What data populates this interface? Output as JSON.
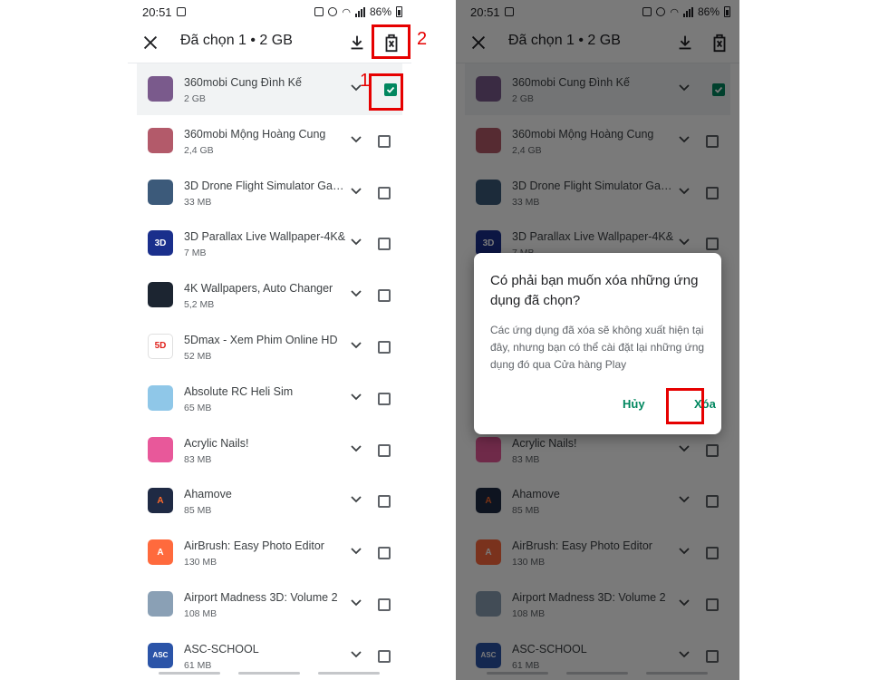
{
  "status_bar": {
    "time": "20:51",
    "battery": "86%"
  },
  "app_bar": {
    "title": "Đã chọn 1 • 2 GB",
    "close_icon": "close-icon",
    "download_icon": "download-icon",
    "delete_icon": "delete-icon"
  },
  "apps": [
    {
      "name": "360mobi Cung Đình Kế",
      "size": "2 GB",
      "checked": true,
      "icon_color": "#7a5a8c",
      "icon_text": ""
    },
    {
      "name": "360mobi Mộng Hoàng Cung",
      "size": "2,4 GB",
      "checked": false,
      "icon_color": "#b35a6a",
      "icon_text": ""
    },
    {
      "name": "3D Drone Flight Simulator Game",
      "size": "33 MB",
      "checked": false,
      "icon_color": "#3c5a7a",
      "icon_text": ""
    },
    {
      "name": "3D Parallax Live Wallpaper-4K&",
      "size": "7 MB",
      "checked": false,
      "icon_color": "#1a2f8c",
      "icon_text": "3D"
    },
    {
      "name": "4K Wallpapers, Auto Changer",
      "size": "5,2 MB",
      "checked": false,
      "icon_color": "#1c2531",
      "icon_text": ""
    },
    {
      "name": "5Dmax - Xem Phim Online HD",
      "size": "52 MB",
      "checked": false,
      "icon_color": "#ffffff",
      "icon_text": "5D"
    },
    {
      "name": "Absolute RC Heli Sim",
      "size": "65 MB",
      "checked": false,
      "icon_color": "#8fc7e8",
      "icon_text": ""
    },
    {
      "name": "Acrylic Nails!",
      "size": "83 MB",
      "checked": false,
      "icon_color": "#e8589a",
      "icon_text": ""
    },
    {
      "name": "Ahamove",
      "size": "85 MB",
      "checked": false,
      "icon_color": "#1f2a44",
      "icon_text": "A"
    },
    {
      "name": "AirBrush: Easy Photo Editor",
      "size": "130 MB",
      "checked": false,
      "icon_color": "#ff6a3d",
      "icon_text": "A"
    },
    {
      "name": "Airport Madness 3D: Volume 2",
      "size": "108 MB",
      "checked": false,
      "icon_color": "#8aa0b5",
      "icon_text": ""
    },
    {
      "name": "ASC-SCHOOL",
      "size": "61 MB",
      "checked": false,
      "icon_color": "#2b54a8",
      "icon_text": "ASC"
    }
  ],
  "dialog": {
    "title": "Có phải bạn muốn xóa những ứng dụng đã chọn?",
    "body": "Các ứng dụng đã xóa sẽ không xuất hiện tại đây, nhưng bạn có thể cài đặt lại những ứng dụng đó qua Cửa hàng Play",
    "cancel_label": "Hủy",
    "confirm_label": "Xóa"
  },
  "annotations": {
    "step1": "1",
    "step2": "2"
  },
  "colors": {
    "accent": "#01875f",
    "highlight": "#e60000",
    "scrim": "rgba(0,0,0,0.52)"
  }
}
